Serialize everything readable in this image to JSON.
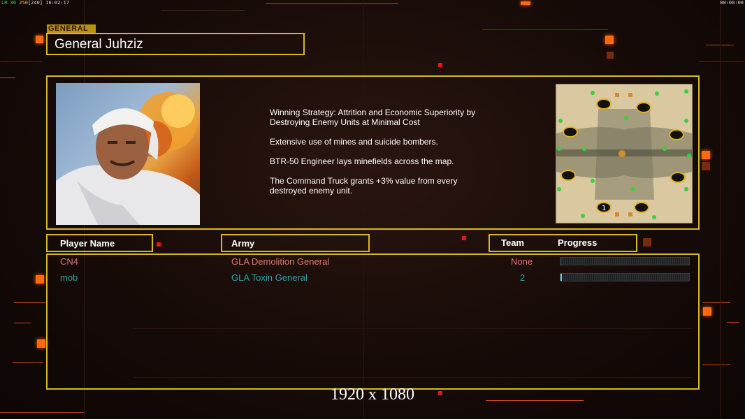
{
  "hud": {
    "fps_prefix": "LR 30",
    "fps_mid": "250",
    "fps_bracket": "[240]",
    "fps_time": "16:02:17",
    "clock": "00:00:00"
  },
  "general_tag": "GENERAL",
  "general_name": "General Juhziz",
  "description": [
    "Winning Strategy: Attrition and Economic Superiority by\n Destroying Enemy Units at Minimal Cost",
    "Extensive use of mines and suicide bombers.",
    "BTR-50 Engineer lays minefields across the map.",
    "The Command Truck grants +3% value from every\n destroyed enemy unit."
  ],
  "columns": {
    "player_name": "Player Name",
    "army": "Army",
    "team": "Team",
    "progress": "Progress"
  },
  "players": [
    {
      "name": "CN4",
      "army": "GLA Demolition General",
      "team": "None",
      "color": "#e07a6a",
      "progress": 0.0
    },
    {
      "name": "mob",
      "army": "GLA Toxin General",
      "team": "2",
      "color": "#2aa6a8",
      "progress": 0.01
    }
  ],
  "minimap_start_label": "1",
  "resolution": "1920 x 1080",
  "colors": {
    "frame": "#d8b820",
    "accent": "#ff6a10"
  }
}
